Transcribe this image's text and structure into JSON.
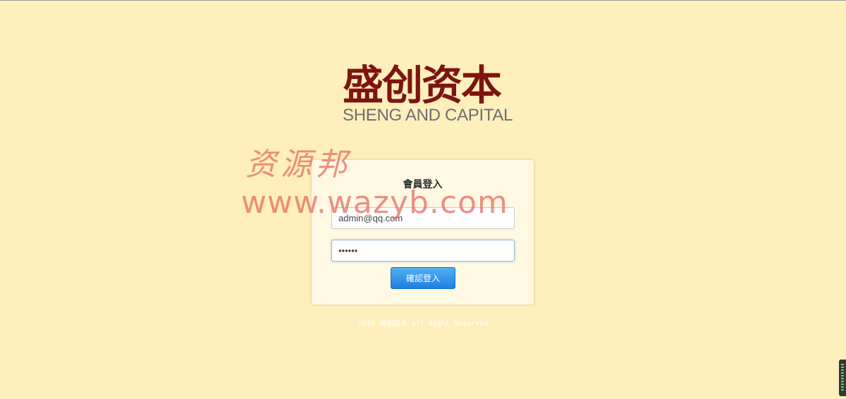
{
  "brand": {
    "name_cn": "盛创资本",
    "name_en": "SHENG AND CAPITAL"
  },
  "watermark": {
    "cn": "资源邦",
    "url": "www.wazyb.com"
  },
  "login": {
    "title": "會員登入",
    "email_value": "admin@qq.com",
    "password_value": "••••••",
    "submit_label": "確認登入"
  },
  "footer": {
    "text": "2016 盛创资本 All Right Reserved"
  },
  "colors": {
    "background": "#ffefbd",
    "brand_red": "#7e1410",
    "button_blue": "#1e80e0",
    "watermark": "#e46e60"
  }
}
